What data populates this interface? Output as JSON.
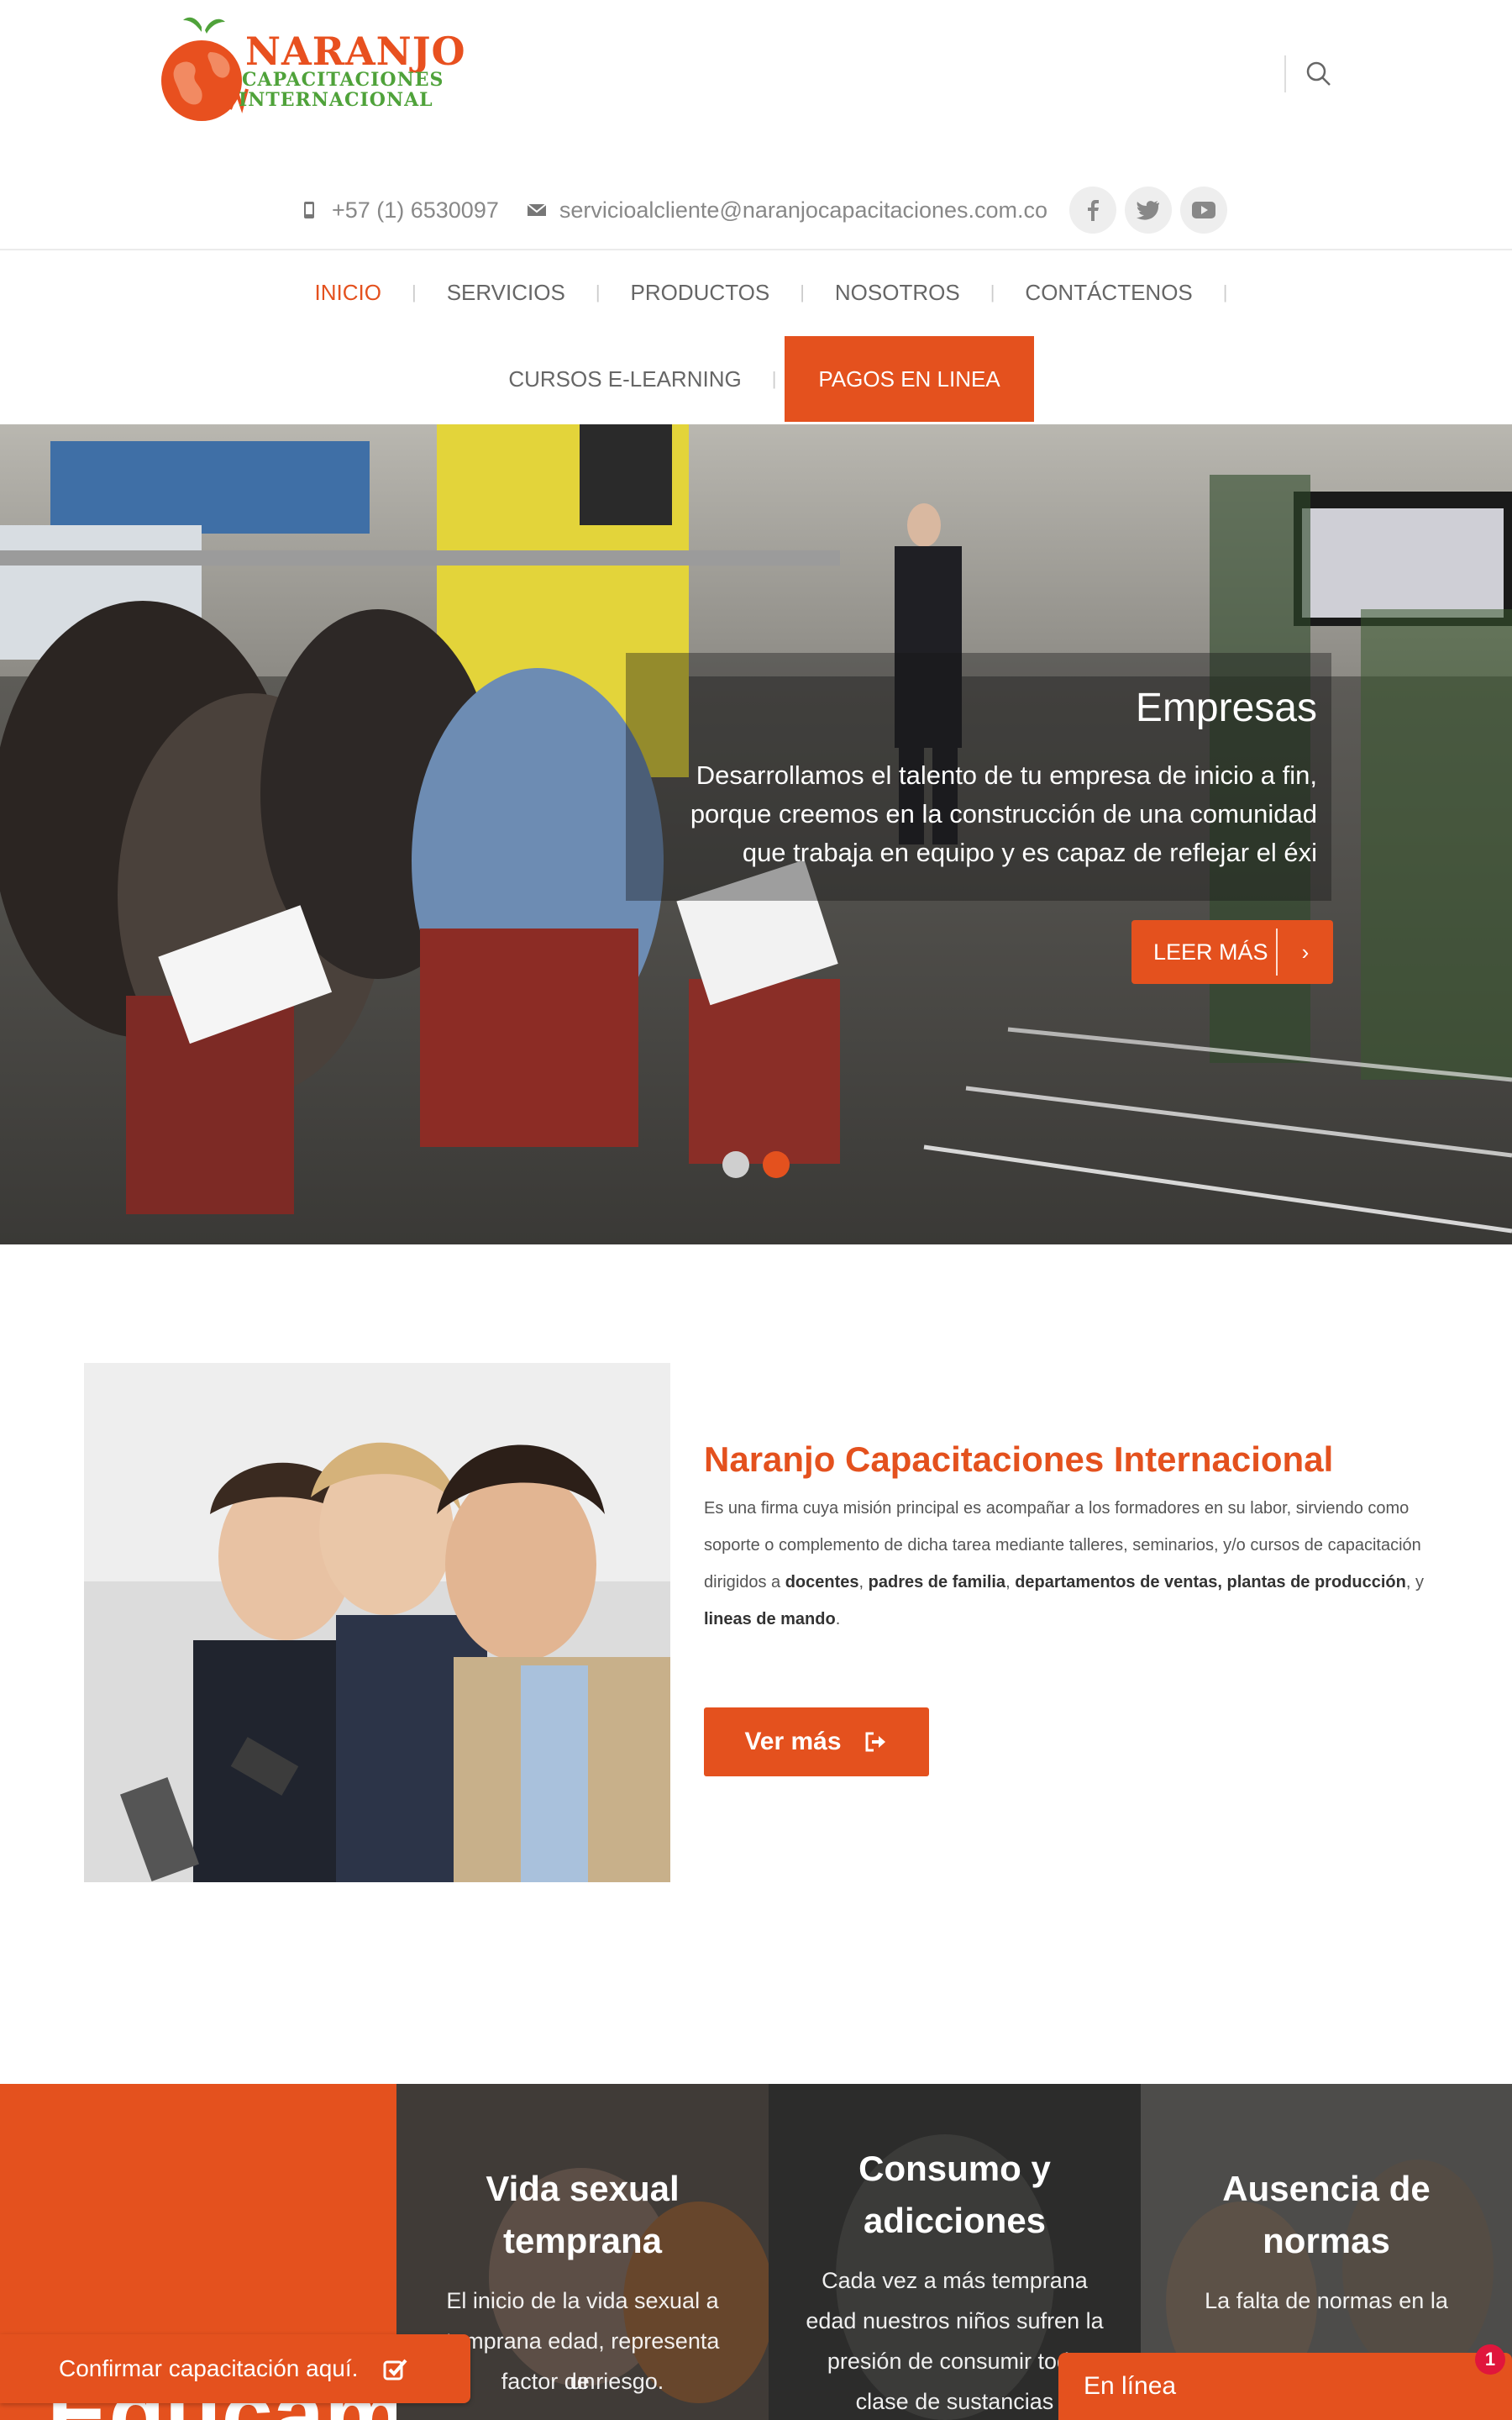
{
  "brand": {
    "name_line1": "NARANJO",
    "name_line2": "CAPACITACIONES",
    "name_line3": "INTERNACIONAL"
  },
  "topbar": {
    "phone": "+57 (1) 6530097",
    "email": "servicioalcliente@naranjocapacitaciones.com.co",
    "social": [
      "facebook-icon",
      "twitter-icon",
      "youtube-icon"
    ]
  },
  "nav": {
    "row1": [
      "INICIO",
      "SERVICIOS",
      "PRODUCTOS",
      "NOSOTROS",
      "CONTÁCTENOS"
    ],
    "row2": [
      "CURSOS E-LEARNING",
      "PAGOS EN LINEA"
    ],
    "active": "INICIO"
  },
  "hero": {
    "title": "Empresas",
    "text": "Desarrollamos el talento de tu empresa de inicio a fin, porque creemos en la construcción de una comunidad que trabaja en equipo y es capaz de reflejar el éxi",
    "button": "LEER MÁS",
    "button_icon": "›",
    "slides": 2,
    "active_slide": 2
  },
  "about": {
    "title": "Naranjo Capacitaciones Internacional",
    "text_intro": "Es una firma cuya misión principal es acompañar a los formadores en su labor, sirviendo como soporte o complemento de dicha tarea mediante talleres, seminarios, y/o cursos de capacitación dirigidos a ",
    "bold1": "docentes",
    "sep1": ", ",
    "bold2": "padres de familia",
    "sep2": ", ",
    "bold3": "departamentos de ventas, plantas de producción",
    "sep3": ", y ",
    "bold4": "lineas de mando",
    "end": ".",
    "button": "Ver más"
  },
  "cards": {
    "orange_text": "Educamo",
    "items": [
      {
        "title_l1": "Vida sexual",
        "title_l2": "temprana",
        "text_l1": "El inicio de la vida sexual a",
        "text_l2": "temprana edad, representa un",
        "text_l3": "factor de riesgo."
      },
      {
        "title_l1": "Consumo y",
        "title_l2": "adicciones",
        "text_l1": "Cada vez a más temprana",
        "text_l2": "edad nuestros niños sufren la",
        "text_l3": "presión de consumir todo",
        "text_l4": "clase de sustancias"
      },
      {
        "title_l1": "Ausencia de",
        "title_l2": "normas",
        "text_l1": "La falta de normas en la"
      }
    ]
  },
  "widgets": {
    "confirm": "Confirmar capacitación aquí.",
    "chat": "En línea",
    "chat_badge": "1"
  },
  "colors": {
    "accent": "#e4511e",
    "brand_green": "#4fa23a",
    "badge": "#e0163c"
  }
}
